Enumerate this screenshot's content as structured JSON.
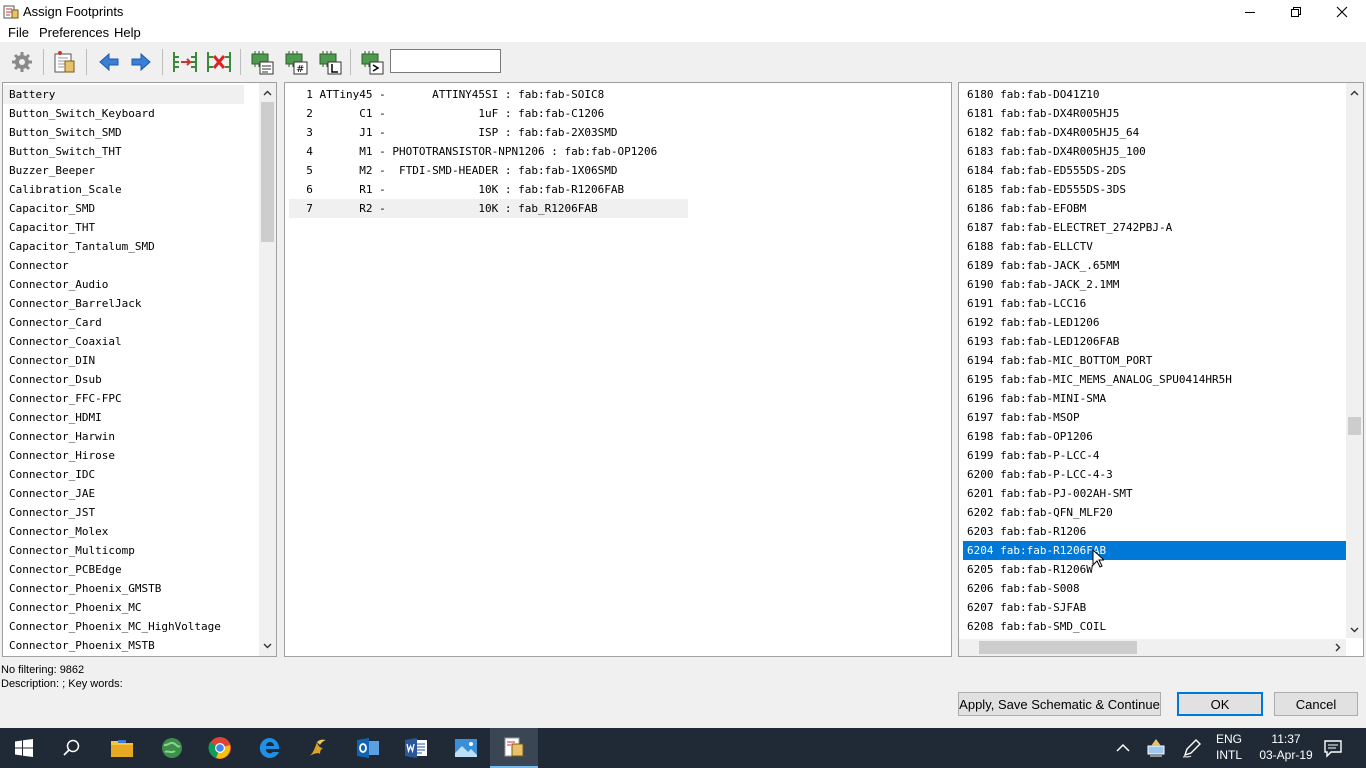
{
  "window": {
    "title": "Assign Footprints",
    "controls": {
      "minimize": "minimize-icon",
      "maximize": "restore-icon",
      "close": "close-icon"
    }
  },
  "menu": {
    "file": "File",
    "preferences": "Preferences",
    "help": "Help"
  },
  "toolbar": {
    "icons": [
      "settings-icon",
      "view-footprint-icon",
      "prev-icon",
      "next-icon",
      "auto-associate-icon",
      "delete-associations-icon",
      "filter-keywords-icon",
      "filter-pincount-icon",
      "filter-library-icon",
      "filter-name-icon"
    ],
    "filter_value": ""
  },
  "libraries": {
    "items": [
      "Battery",
      "Button_Switch_Keyboard",
      "Button_Switch_SMD",
      "Button_Switch_THT",
      "Buzzer_Beeper",
      "Calibration_Scale",
      "Capacitor_SMD",
      "Capacitor_THT",
      "Capacitor_Tantalum_SMD",
      "Connector",
      "Connector_Audio",
      "Connector_BarrelJack",
      "Connector_Card",
      "Connector_Coaxial",
      "Connector_DIN",
      "Connector_Dsub",
      "Connector_FFC-FPC",
      "Connector_HDMI",
      "Connector_Harwin",
      "Connector_Hirose",
      "Connector_IDC",
      "Connector_JAE",
      "Connector_JST",
      "Connector_Molex",
      "Connector_Multicomp",
      "Connector_PCBEdge",
      "Connector_Phoenix_GMSTB",
      "Connector_Phoenix_MC",
      "Connector_Phoenix_MC_HighVoltage",
      "Connector_Phoenix_MSTB"
    ],
    "selected_index": 0
  },
  "components": {
    "rows": [
      "  1 ATTiny45 -       ATTINY45SI : fab:fab-SOIC8",
      "  2       C1 -              1uF : fab:fab-C1206",
      "  3       J1 -              ISP : fab:fab-2X03SMD",
      "  4       M1 - PHOTOTRANSISTOR-NPN1206 : fab:fab-OP1206",
      "  5       M2 -  FTDI-SMD-HEADER : fab:fab-1X06SMD",
      "  6       R1 -              10K : fab:fab-R1206FAB",
      "  7       R2 -              10K : fab_R1206FAB"
    ],
    "selected_index": 6
  },
  "footprints": {
    "rows": [
      "6180 fab:fab-DO41Z10",
      "6181 fab:fab-DX4R005HJ5",
      "6182 fab:fab-DX4R005HJ5_64",
      "6183 fab:fab-DX4R005HJ5_100",
      "6184 fab:fab-ED555DS-2DS",
      "6185 fab:fab-ED555DS-3DS",
      "6186 fab:fab-EFOBM",
      "6187 fab:fab-ELECTRET_2742PBJ-A",
      "6188 fab:fab-ELLCTV",
      "6189 fab:fab-JACK_.65MM",
      "6190 fab:fab-JACK_2.1MM",
      "6191 fab:fab-LCC16",
      "6192 fab:fab-LED1206",
      "6193 fab:fab-LED1206FAB",
      "6194 fab:fab-MIC_BOTTOM_PORT",
      "6195 fab:fab-MIC_MEMS_ANALOG_SPU0414HR5H",
      "6196 fab:fab-MINI-SMA",
      "6197 fab:fab-MSOP",
      "6198 fab:fab-OP1206",
      "6199 fab:fab-P-LCC-4",
      "6200 fab:fab-P-LCC-4-3",
      "6201 fab:fab-PJ-002AH-SMT",
      "6202 fab:fab-QFN_MLF20",
      "6203 fab:fab-R1206",
      "6204 fab:fab-R1206FAB",
      "6205 fab:fab-R1206W",
      "6206 fab:fab-S008",
      "6207 fab:fab-SJFAB",
      "6208 fab:fab-SMD_COIL"
    ],
    "selected_index": 24
  },
  "status": {
    "filtering": "No filtering: 9862",
    "description": "Description: ;  Key words:"
  },
  "buttons": {
    "apply": "Apply, Save Schematic & Continue",
    "ok": "OK",
    "cancel": "Cancel"
  },
  "taskbar": {
    "apps": [
      "start-icon",
      "search-icon",
      "file-explorer-icon",
      "network-globe-icon",
      "chrome-icon",
      "edge-icon",
      "inkscape-icon",
      "outlook-icon",
      "word-icon",
      "photos-icon",
      "kicad-icon"
    ],
    "lang_top": "ENG",
    "lang_bottom": "INTL",
    "time": "11:37",
    "date": "03-Apr-19"
  },
  "colors": {
    "selection": "#0078d7",
    "taskbar": "#1f2a36"
  }
}
